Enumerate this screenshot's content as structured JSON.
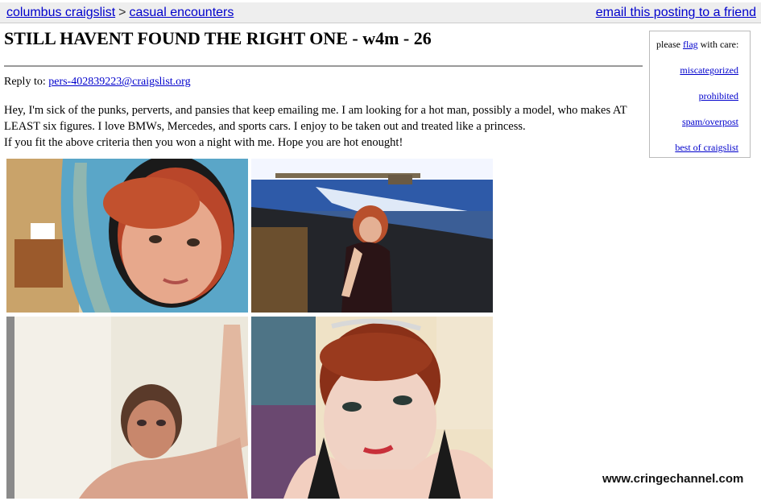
{
  "breadcrumb": {
    "city": "columbus craigslist",
    "separator": ">",
    "section": "casual encounters"
  },
  "email_link": "email this posting to a friend",
  "posting": {
    "title": "STILL HAVENT FOUND THE RIGHT ONE - w4m - 26",
    "reply_label": "Reply to:",
    "reply_email": "pers-402839223@craigslist.org",
    "body_line1": "Hey, I'm sick of the punks, perverts, and pansies that keep emailing me. I am looking for a hot man, possibly a model, who makes AT LEAST six figures. I love BMWs, Mercedes, and sports cars. I enjoy to be taken out and treated like a princess.",
    "body_line2": "If you fit the above criteria then you won a night with me. Hope you are hot enought!"
  },
  "flag_box": {
    "prefix": "please",
    "flag_word": "flag",
    "suffix": "with care:",
    "links": [
      "miscategorized",
      "prohibited",
      "spam/overpost",
      "best of craigslist"
    ]
  },
  "watermark": "www.cringechannel.com",
  "colors": {
    "link": "#0000cc",
    "topbar_bg": "#eeeeee"
  }
}
